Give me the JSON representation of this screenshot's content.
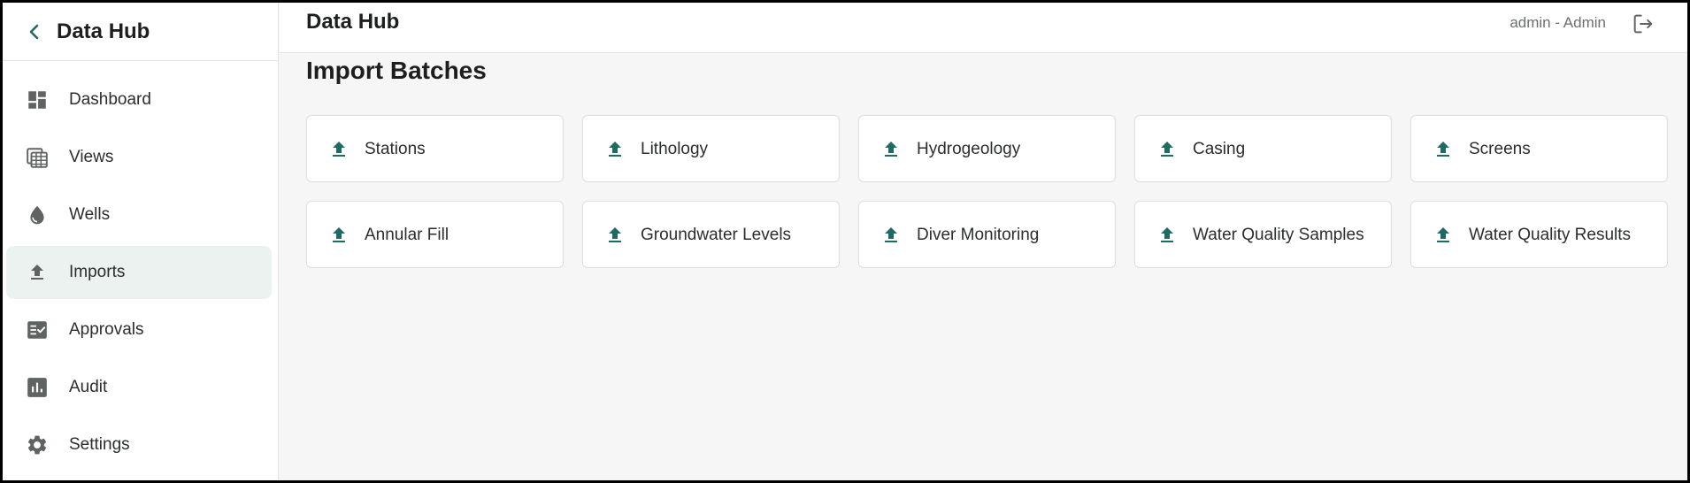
{
  "sidebar": {
    "title": "Data Hub",
    "items": [
      {
        "label": "Dashboard",
        "icon": "dashboard-icon",
        "active": false
      },
      {
        "label": "Views",
        "icon": "views-calendar-icon",
        "active": false
      },
      {
        "label": "Wells",
        "icon": "water-drop-icon",
        "active": false
      },
      {
        "label": "Imports",
        "icon": "upload-icon",
        "active": true
      },
      {
        "label": "Approvals",
        "icon": "approval-checklist-icon",
        "active": false
      },
      {
        "label": "Audit",
        "icon": "bar-chart-icon",
        "active": false
      },
      {
        "label": "Settings",
        "icon": "gear-icon",
        "active": false
      }
    ]
  },
  "header": {
    "title": "Data Hub",
    "user": "admin - Admin"
  },
  "main": {
    "title": "Import Batches",
    "cards": [
      {
        "label": "Stations"
      },
      {
        "label": "Lithology"
      },
      {
        "label": "Hydrogeology"
      },
      {
        "label": "Casing"
      },
      {
        "label": "Screens"
      },
      {
        "label": "Annular Fill"
      },
      {
        "label": "Groundwater Levels"
      },
      {
        "label": "Diver Monitoring"
      },
      {
        "label": "Water Quality Samples"
      },
      {
        "label": "Water Quality Results"
      }
    ]
  },
  "colors": {
    "accent": "#1e6b64",
    "icon_gray": "#5f6462",
    "active_bg": "#ecf2f0",
    "background": "#f5f6f5"
  }
}
